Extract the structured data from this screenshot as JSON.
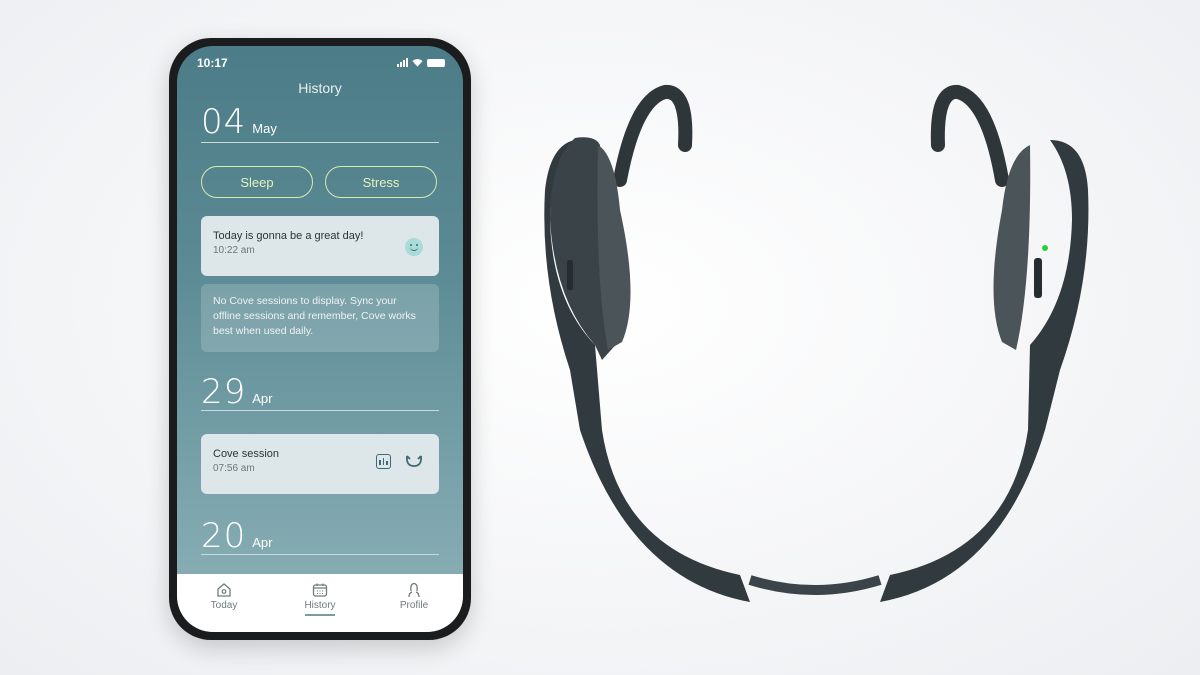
{
  "status_bar": {
    "time": "10:17"
  },
  "screen": {
    "title": "History"
  },
  "filters": [
    {
      "label": "Sleep"
    },
    {
      "label": "Stress"
    }
  ],
  "sections": [
    {
      "day": "04",
      "month": "May",
      "entries": [
        {
          "type": "note",
          "title": "Today is gonna be a great day!",
          "time": "10:22 am",
          "icon": "smiley-icon"
        },
        {
          "type": "message",
          "text": "No Cove sessions to display. Sync your offline sessions and remember, Cove works best when used daily."
        }
      ]
    },
    {
      "day": "29",
      "month": "Apr",
      "entries": [
        {
          "type": "session",
          "title": "Cove session",
          "time": "07:56 am",
          "icons": [
            "bar-chart-icon",
            "headband-icon"
          ]
        }
      ]
    },
    {
      "day": "20",
      "month": "Apr",
      "entries": []
    }
  ],
  "nav": [
    {
      "label": "Today",
      "icon": "home-icon"
    },
    {
      "label": "History",
      "icon": "calendar-icon",
      "active": true
    },
    {
      "label": "Profile",
      "icon": "profile-icon"
    }
  ],
  "colors": {
    "accent_pill": "#d7ebb0",
    "screen_bg": "#4c7c87",
    "device": "#2f3639",
    "led": "#2ecc40"
  }
}
